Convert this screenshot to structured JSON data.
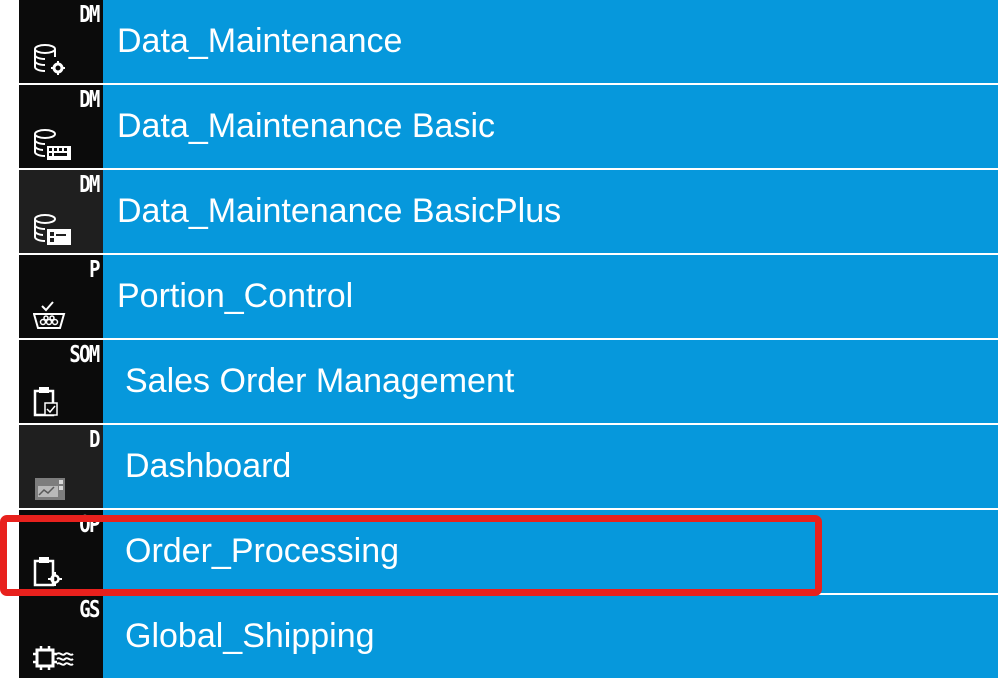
{
  "colors": {
    "item_background": "#0698dc",
    "tile_background": "#0b0b0b",
    "highlight_border": "#e8211d",
    "text": "#ffffff"
  },
  "menu": {
    "items": [
      {
        "badge": "DM",
        "label": "Data_Maintenance",
        "icon": "database-gear-icon"
      },
      {
        "badge": "DM",
        "label": "Data_Maintenance Basic",
        "icon": "database-keyboard-icon"
      },
      {
        "badge": "DM",
        "label": "Data_Maintenance BasicPlus",
        "icon": "database-card-icon"
      },
      {
        "badge": "P",
        "label": "Portion_Control",
        "icon": "basket-check-icon"
      },
      {
        "badge": "SOM",
        "label": "Sales Order Management",
        "icon": "clipboard-check-icon"
      },
      {
        "badge": "D",
        "label": "Dashboard",
        "icon": "dashboard-screen-icon"
      },
      {
        "badge": "OP",
        "label": "Order_Processing",
        "icon": "clipboard-gear-icon"
      },
      {
        "badge": "GS",
        "label": "Global_Shipping",
        "icon": "chip-waves-icon"
      }
    ],
    "highlighted_item": "Order_Processing"
  }
}
